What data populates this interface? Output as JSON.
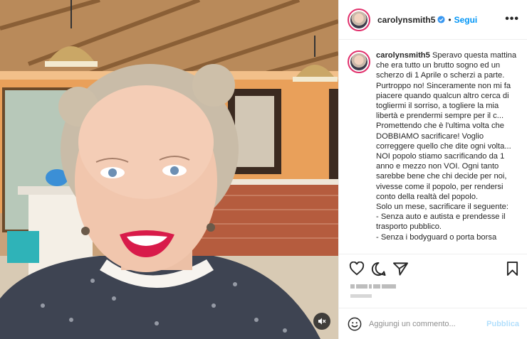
{
  "post": {
    "username": "carolynsmith5",
    "separator": "•",
    "follow_label": "Segui",
    "more_label": "•••",
    "caption": " Speravo questa mattina che era tutto un brutto sogno ed un scherzo di 1 Aprile o scherzi a parte. Purtroppo no! Sinceramente non mi fa piacere quando qualcun altro cerca di togliermi il sorriso, a togliere la mia libertà e prendermi sempre per il c... Promettendo che è l'ultima volta che DOBBIAMO sacrificare! Voglio correggere quello che dite ogni volta... NOI popolo stiamo sacrificando da 1 anno e mezzo non VOI. Ogni tanto sarebbe bene che chi decide per noi, vivesse come il popolo, per rendersi conto della realtà del popolo.\nSolo un mese, sacrificare il seguente:\n- Senza auto e autista e prendesse il trasporto pubblico.\n- Senza i bodyguard o porta borsa"
  },
  "icons": {
    "verified": "verified-badge-icon",
    "like": "heart-icon",
    "comment": "comment-icon",
    "share": "paper-plane-icon",
    "save": "bookmark-icon",
    "emoji": "emoji-icon",
    "mute": "muted-speaker-icon"
  },
  "colors": {
    "accent": "#0095f6",
    "publish_disabled": "#b2dffc",
    "story_ring": "#e1306c"
  },
  "comment_box": {
    "placeholder": "Aggiungi un commento...",
    "publish_label": "Pubblica"
  }
}
